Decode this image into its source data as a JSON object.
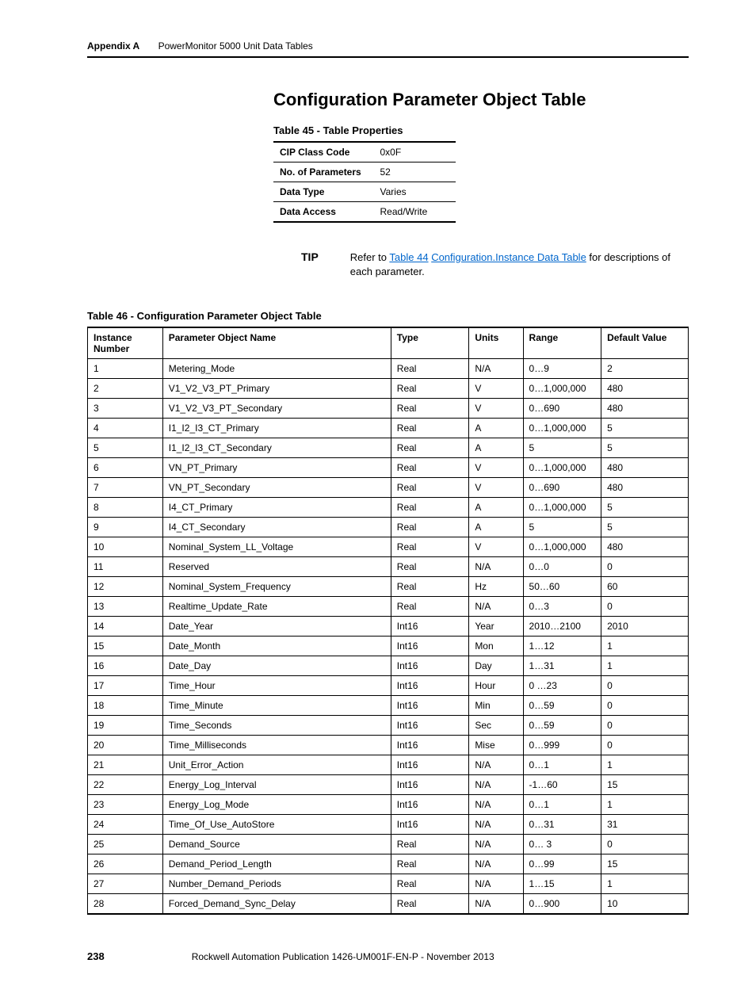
{
  "header": {
    "appendix": "Appendix A",
    "title": "PowerMonitor 5000 Unit Data Tables"
  },
  "section_title": "Configuration Parameter Object Table",
  "table45": {
    "caption": "Table 45 - Table Properties",
    "rows": [
      {
        "label": "CIP Class Code",
        "value": "0x0F"
      },
      {
        "label": "No. of Parameters",
        "value": "52"
      },
      {
        "label": "Data Type",
        "value": "Varies"
      },
      {
        "label": "Data Access",
        "value": "Read/Write"
      }
    ]
  },
  "tip": {
    "label": "TIP",
    "prefix": "Refer to ",
    "link1": "Table 44",
    "link2": "Configuration.Instance Data Table",
    "suffix": " for descriptions of each parameter."
  },
  "table46": {
    "caption": "Table 46 - Configuration Parameter Object Table",
    "headers": [
      "Instance Number",
      "Parameter Object Name",
      "Type",
      "Units",
      "Range",
      "Default Value"
    ],
    "rows": [
      [
        "1",
        "Metering_Mode",
        "Real",
        "N/A",
        "0…9",
        "2"
      ],
      [
        "2",
        "V1_V2_V3_PT_Primary",
        "Real",
        "V",
        "0…1,000,000",
        "480"
      ],
      [
        "3",
        "V1_V2_V3_PT_Secondary",
        "Real",
        "V",
        "0…690",
        "480"
      ],
      [
        "4",
        "I1_I2_I3_CT_Primary",
        "Real",
        "A",
        "0…1,000,000",
        "5"
      ],
      [
        "5",
        "I1_I2_I3_CT_Secondary",
        "Real",
        "A",
        "5",
        "5"
      ],
      [
        "6",
        "VN_PT_Primary",
        "Real",
        "V",
        "0…1,000,000",
        "480"
      ],
      [
        "7",
        "VN_PT_Secondary",
        "Real",
        "V",
        "0…690",
        "480"
      ],
      [
        "8",
        "I4_CT_Primary",
        "Real",
        "A",
        "0…1,000,000",
        "5"
      ],
      [
        "9",
        "I4_CT_Secondary",
        "Real",
        "A",
        "5",
        "5"
      ],
      [
        "10",
        "Nominal_System_LL_Voltage",
        "Real",
        "V",
        "0…1,000,000",
        "480"
      ],
      [
        "11",
        "Reserved",
        "Real",
        "N/A",
        "0…0",
        "0"
      ],
      [
        "12",
        "Nominal_System_Frequency",
        "Real",
        "Hz",
        "50…60",
        "60"
      ],
      [
        "13",
        "Realtime_Update_Rate",
        "Real",
        "N/A",
        "0…3",
        "0"
      ],
      [
        "14",
        "Date_Year",
        "Int16",
        "Year",
        "2010…2100",
        "2010"
      ],
      [
        "15",
        "Date_Month",
        "Int16",
        "Mon",
        "1…12",
        "1"
      ],
      [
        "16",
        "Date_Day",
        "Int16",
        "Day",
        "1…31",
        "1"
      ],
      [
        "17",
        "Time_Hour",
        "Int16",
        "Hour",
        "0 …23",
        "0"
      ],
      [
        "18",
        "Time_Minute",
        "Int16",
        "Min",
        "0…59",
        "0"
      ],
      [
        "19",
        "Time_Seconds",
        "Int16",
        "Sec",
        "0…59",
        "0"
      ],
      [
        "20",
        "Time_Milliseconds",
        "Int16",
        "Mise",
        "0…999",
        "0"
      ],
      [
        "21",
        "Unit_Error_Action",
        "Int16",
        "N/A",
        "0…1",
        "1"
      ],
      [
        "22",
        "Energy_Log_Interval",
        "Int16",
        "N/A",
        "-1…60",
        "15"
      ],
      [
        "23",
        "Energy_Log_Mode",
        "Int16",
        "N/A",
        "0…1",
        "1"
      ],
      [
        "24",
        "Time_Of_Use_AutoStore",
        "Int16",
        "N/A",
        "0…31",
        "31"
      ],
      [
        "25",
        "Demand_Source",
        "Real",
        "N/A",
        "0… 3",
        "0"
      ],
      [
        "26",
        "Demand_Period_Length",
        "Real",
        "N/A",
        "0…99",
        "15"
      ],
      [
        "27",
        "Number_Demand_Periods",
        "Real",
        "N/A",
        "1…15",
        "1"
      ],
      [
        "28",
        "Forced_Demand_Sync_Delay",
        "Real",
        "N/A",
        "0…900",
        "10"
      ]
    ]
  },
  "footer": {
    "page": "238",
    "pub": "Rockwell Automation Publication 1426-UM001F-EN-P - November 2013"
  }
}
